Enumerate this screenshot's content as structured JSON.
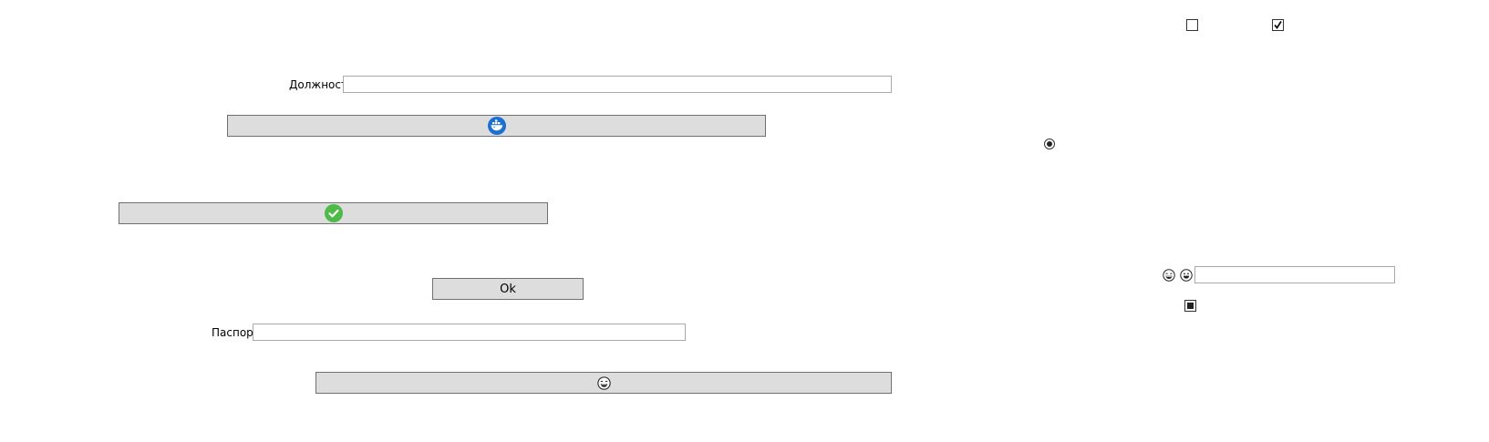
{
  "fields": {
    "position": {
      "label": "Должность",
      "value": ""
    },
    "passport": {
      "label": "Паспорт",
      "value": ""
    },
    "right_text": {
      "value": ""
    }
  },
  "buttons": {
    "ok_label": "Ok"
  },
  "checkboxes": {
    "first_checked": false,
    "second_checked": true,
    "third_state": "indeterminate"
  },
  "radio": {
    "selected": true
  },
  "icons": {
    "docker_button_icon": "docker-whale-icon",
    "check_button_icon": "check-circle-icon",
    "emoji_button_icon": "grinning-face-icon",
    "emoji_left": "grinning-face-icon",
    "emoji_right": "smiling-face-icon"
  },
  "colors": {
    "button_bg": "#dddddd",
    "button_border": "#707070",
    "docker_blue": "#1d6fd1",
    "check_green": "#4cbb47"
  }
}
